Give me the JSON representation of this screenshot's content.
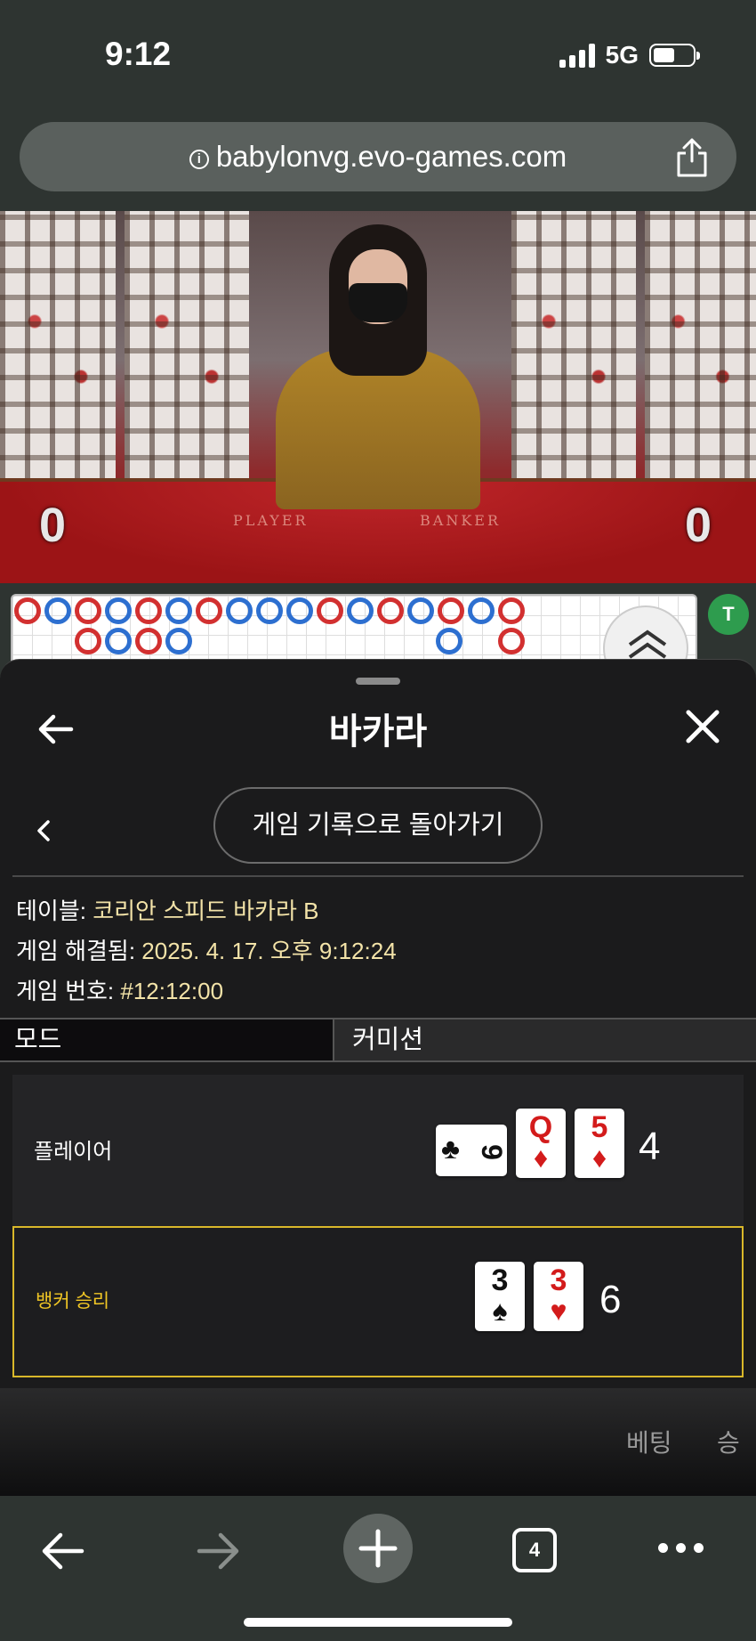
{
  "status_bar": {
    "time": "9:12",
    "network": "5G"
  },
  "browser": {
    "url": "babylonvg.evo-games.com",
    "tab_count": "4"
  },
  "video": {
    "player_score": "0",
    "banker_score": "0",
    "player_label": "PLAYER",
    "banker_label": "BANKER"
  },
  "sidebar_badges": [
    {
      "label": "T",
      "color": "#2e9c4e"
    }
  ],
  "panel": {
    "title": "바카라",
    "back_to_history": "게임 기록으로 돌아가기",
    "table_label": "테이블: ",
    "table_value": "코리안 스피드 바카라 B",
    "resolved_label": "게임 해결됨: ",
    "resolved_value": "2025. 4. 17. 오후 9:12:24",
    "game_no_label": "게임 번호: ",
    "game_no_value": "#12:12:00",
    "tabs": {
      "mode": "모드",
      "commission": "커미션"
    },
    "player": {
      "name": "플레이어",
      "total": "4",
      "cards": [
        {
          "rank": "9",
          "suit": "♣",
          "color": "black"
        },
        {
          "rank": "Q",
          "suit": "♦",
          "color": "red"
        },
        {
          "rank": "5",
          "suit": "♦",
          "color": "red"
        }
      ]
    },
    "banker": {
      "name": "뱅커 승리",
      "total": "6",
      "cards": [
        {
          "rank": "3",
          "suit": "♠",
          "color": "black"
        },
        {
          "rank": "3",
          "suit": "♥",
          "color": "red"
        }
      ]
    },
    "columns": {
      "bet": "베팅",
      "win": "승"
    }
  },
  "colors": {
    "banker_highlight": "#d9b82a",
    "bead_red": "#d23030",
    "bead_blue": "#2d6fd0"
  }
}
